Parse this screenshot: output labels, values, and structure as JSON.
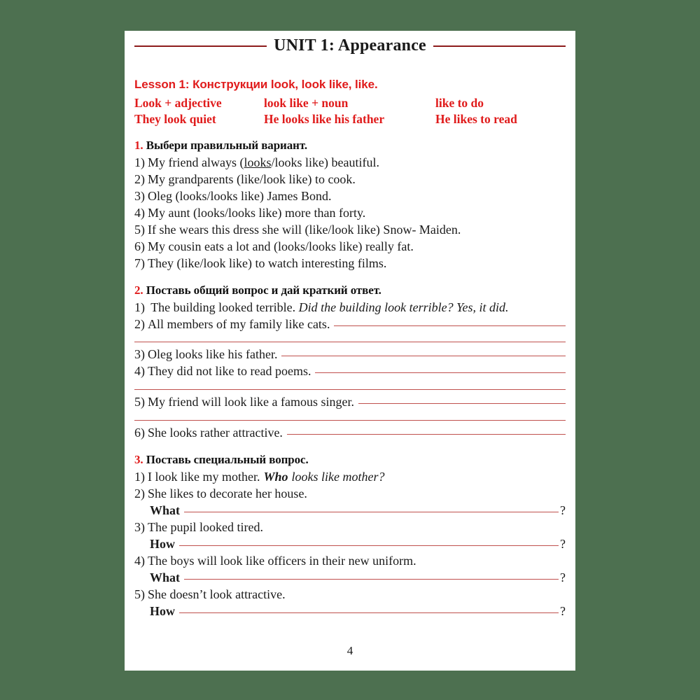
{
  "page": {
    "unit_title": "UNIT 1: Appearance",
    "page_number": "4",
    "accent_red": "#e01b1b",
    "rule_red": "#8d1c1c",
    "blank_red": "#c0504d",
    "background_green": "#4d7050"
  },
  "lesson": {
    "title": "Lesson 1: Конструкции look, look like, like.",
    "formulas": [
      {
        "col1": "Look + adjective",
        "col2": "look like + noun",
        "col3": "like to do"
      },
      {
        "col1": "They look quiet",
        "col2": "He looks like his father",
        "col3": "He likes to read"
      }
    ]
  },
  "exercises": [
    {
      "number": "1.",
      "heading": "Выбери правильный вариант.",
      "items": [
        {
          "marker": "1)",
          "pre": "My friend always (",
          "underlined": "looks",
          "post": "/looks like) beautiful."
        },
        {
          "marker": "2)",
          "text": "My grandparents (like/look like) to cook."
        },
        {
          "marker": "3)",
          "text": "Oleg (looks/looks like) James Bond."
        },
        {
          "marker": "4)",
          "text": "My aunt (looks/looks like) more than forty."
        },
        {
          "marker": "5)",
          "text": "If she wears this dress she will (like/look like) Snow- Maiden."
        },
        {
          "marker": "6)",
          "text": "My cousin eats a lot and (looks/looks like) really fat."
        },
        {
          "marker": "7)",
          "text": "They (like/look like) to watch interesting films."
        }
      ]
    },
    {
      "number": "2.",
      "heading": "Поставь общий вопрос и дай краткий ответ.",
      "items": [
        {
          "marker": "1)",
          "text": "The building looked terrible.",
          "answer": "Did the building look terrible? Yes, it did."
        },
        {
          "marker": "2)",
          "text": "All members of my family like cats."
        },
        {
          "marker": "3)",
          "text": "Oleg looks like his father."
        },
        {
          "marker": "4)",
          "text": "They did not like to read poems."
        },
        {
          "marker": "5)",
          "text": "My friend will look like a famous singer."
        },
        {
          "marker": "6)",
          "text": "She looks rather attractive."
        }
      ]
    },
    {
      "number": "3.",
      "heading": "Поставь специальный вопрос.",
      "items": [
        {
          "marker": "1)",
          "text": "I look like my mother.",
          "answer_bold": "Who",
          "answer_italic": "looks like mother?"
        },
        {
          "marker": "2)",
          "text": "She likes to decorate her house.",
          "qword": "What",
          "qmark": "?"
        },
        {
          "marker": "3)",
          "text": "The pupil looked tired.",
          "qword": "How",
          "qmark": "?"
        },
        {
          "marker": "4)",
          "text": "The boys will look like officers in their new uniform.",
          "qword": "What",
          "qmark": "?"
        },
        {
          "marker": "5)",
          "text": "She doesn’t look attractive.",
          "qword": "How",
          "qmark": "?"
        }
      ]
    }
  ]
}
